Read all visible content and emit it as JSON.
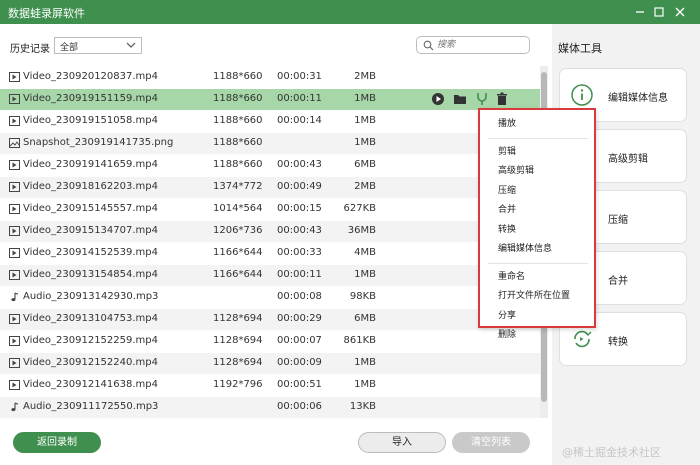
{
  "app": {
    "title": "数据蛙录屏软件"
  },
  "history": {
    "label": "历史记录",
    "filter_value": "全部"
  },
  "search": {
    "placeholder": "搜索"
  },
  "files": [
    {
      "type": "video",
      "name": "Video_230920120837.mp4",
      "resolution": "1188*660",
      "duration": "00:00:31",
      "size": "2MB"
    },
    {
      "type": "video",
      "name": "Video_230919151159.mp4",
      "resolution": "1188*660",
      "duration": "00:00:11",
      "size": "1MB"
    },
    {
      "type": "video",
      "name": "Video_230919151058.mp4",
      "resolution": "1188*660",
      "duration": "00:00:14",
      "size": "1MB"
    },
    {
      "type": "image",
      "name": "Snapshot_230919141735.png",
      "resolution": "1188*660",
      "duration": "",
      "size": "1MB"
    },
    {
      "type": "video",
      "name": "Video_230919141659.mp4",
      "resolution": "1188*660",
      "duration": "00:00:43",
      "size": "6MB"
    },
    {
      "type": "video",
      "name": "Video_230918162203.mp4",
      "resolution": "1374*772",
      "duration": "00:00:49",
      "size": "2MB"
    },
    {
      "type": "video",
      "name": "Video_230915145557.mp4",
      "resolution": "1014*564",
      "duration": "00:00:15",
      "size": "627KB"
    },
    {
      "type": "video",
      "name": "Video_230915134707.mp4",
      "resolution": "1206*736",
      "duration": "00:00:43",
      "size": "36MB"
    },
    {
      "type": "video",
      "name": "Video_230914152539.mp4",
      "resolution": "1166*644",
      "duration": "00:00:33",
      "size": "4MB"
    },
    {
      "type": "video",
      "name": "Video_230913154854.mp4",
      "resolution": "1166*644",
      "duration": "00:00:11",
      "size": "1MB"
    },
    {
      "type": "audio",
      "name": "Audio_230913142930.mp3",
      "resolution": "",
      "duration": "00:00:08",
      "size": "98KB"
    },
    {
      "type": "video",
      "name": "Video_230913104753.mp4",
      "resolution": "1128*694",
      "duration": "00:00:29",
      "size": "6MB"
    },
    {
      "type": "video",
      "name": "Video_230912152259.mp4",
      "resolution": "1128*694",
      "duration": "00:00:07",
      "size": "861KB"
    },
    {
      "type": "video",
      "name": "Video_230912152240.mp4",
      "resolution": "1128*694",
      "duration": "00:00:09",
      "size": "1MB"
    },
    {
      "type": "video",
      "name": "Video_230912141638.mp4",
      "resolution": "1192*796",
      "duration": "00:00:51",
      "size": "1MB"
    },
    {
      "type": "audio",
      "name": "Audio_230911172550.mp3",
      "resolution": "",
      "duration": "00:00:06",
      "size": "13KB"
    }
  ],
  "context_menu": {
    "groups": [
      [
        "播放"
      ],
      [
        "剪辑",
        "高级剪辑",
        "压缩",
        "合并",
        "转换",
        "编辑媒体信息"
      ],
      [
        "重命名",
        "打开文件所在位置",
        "分享",
        "删除"
      ]
    ]
  },
  "sidebar": {
    "title": "媒体工具",
    "tools": [
      {
        "label": "编辑媒体信息",
        "icon": "info-icon"
      },
      {
        "label": "高级剪辑",
        "icon": "advanced-edit-icon"
      },
      {
        "label": "压缩",
        "icon": "compress-icon"
      },
      {
        "label": "合并",
        "icon": "merge-icon"
      },
      {
        "label": "转换",
        "icon": "convert-icon"
      }
    ]
  },
  "buttons": {
    "back": "返回录制",
    "import": "导入",
    "clear": "清空列表"
  },
  "watermark": "@稀土掘金技术社区",
  "colors": {
    "accent": "#3f8f4e",
    "selection": "#a7d7a9",
    "highlight_border": "#d83b3b"
  }
}
